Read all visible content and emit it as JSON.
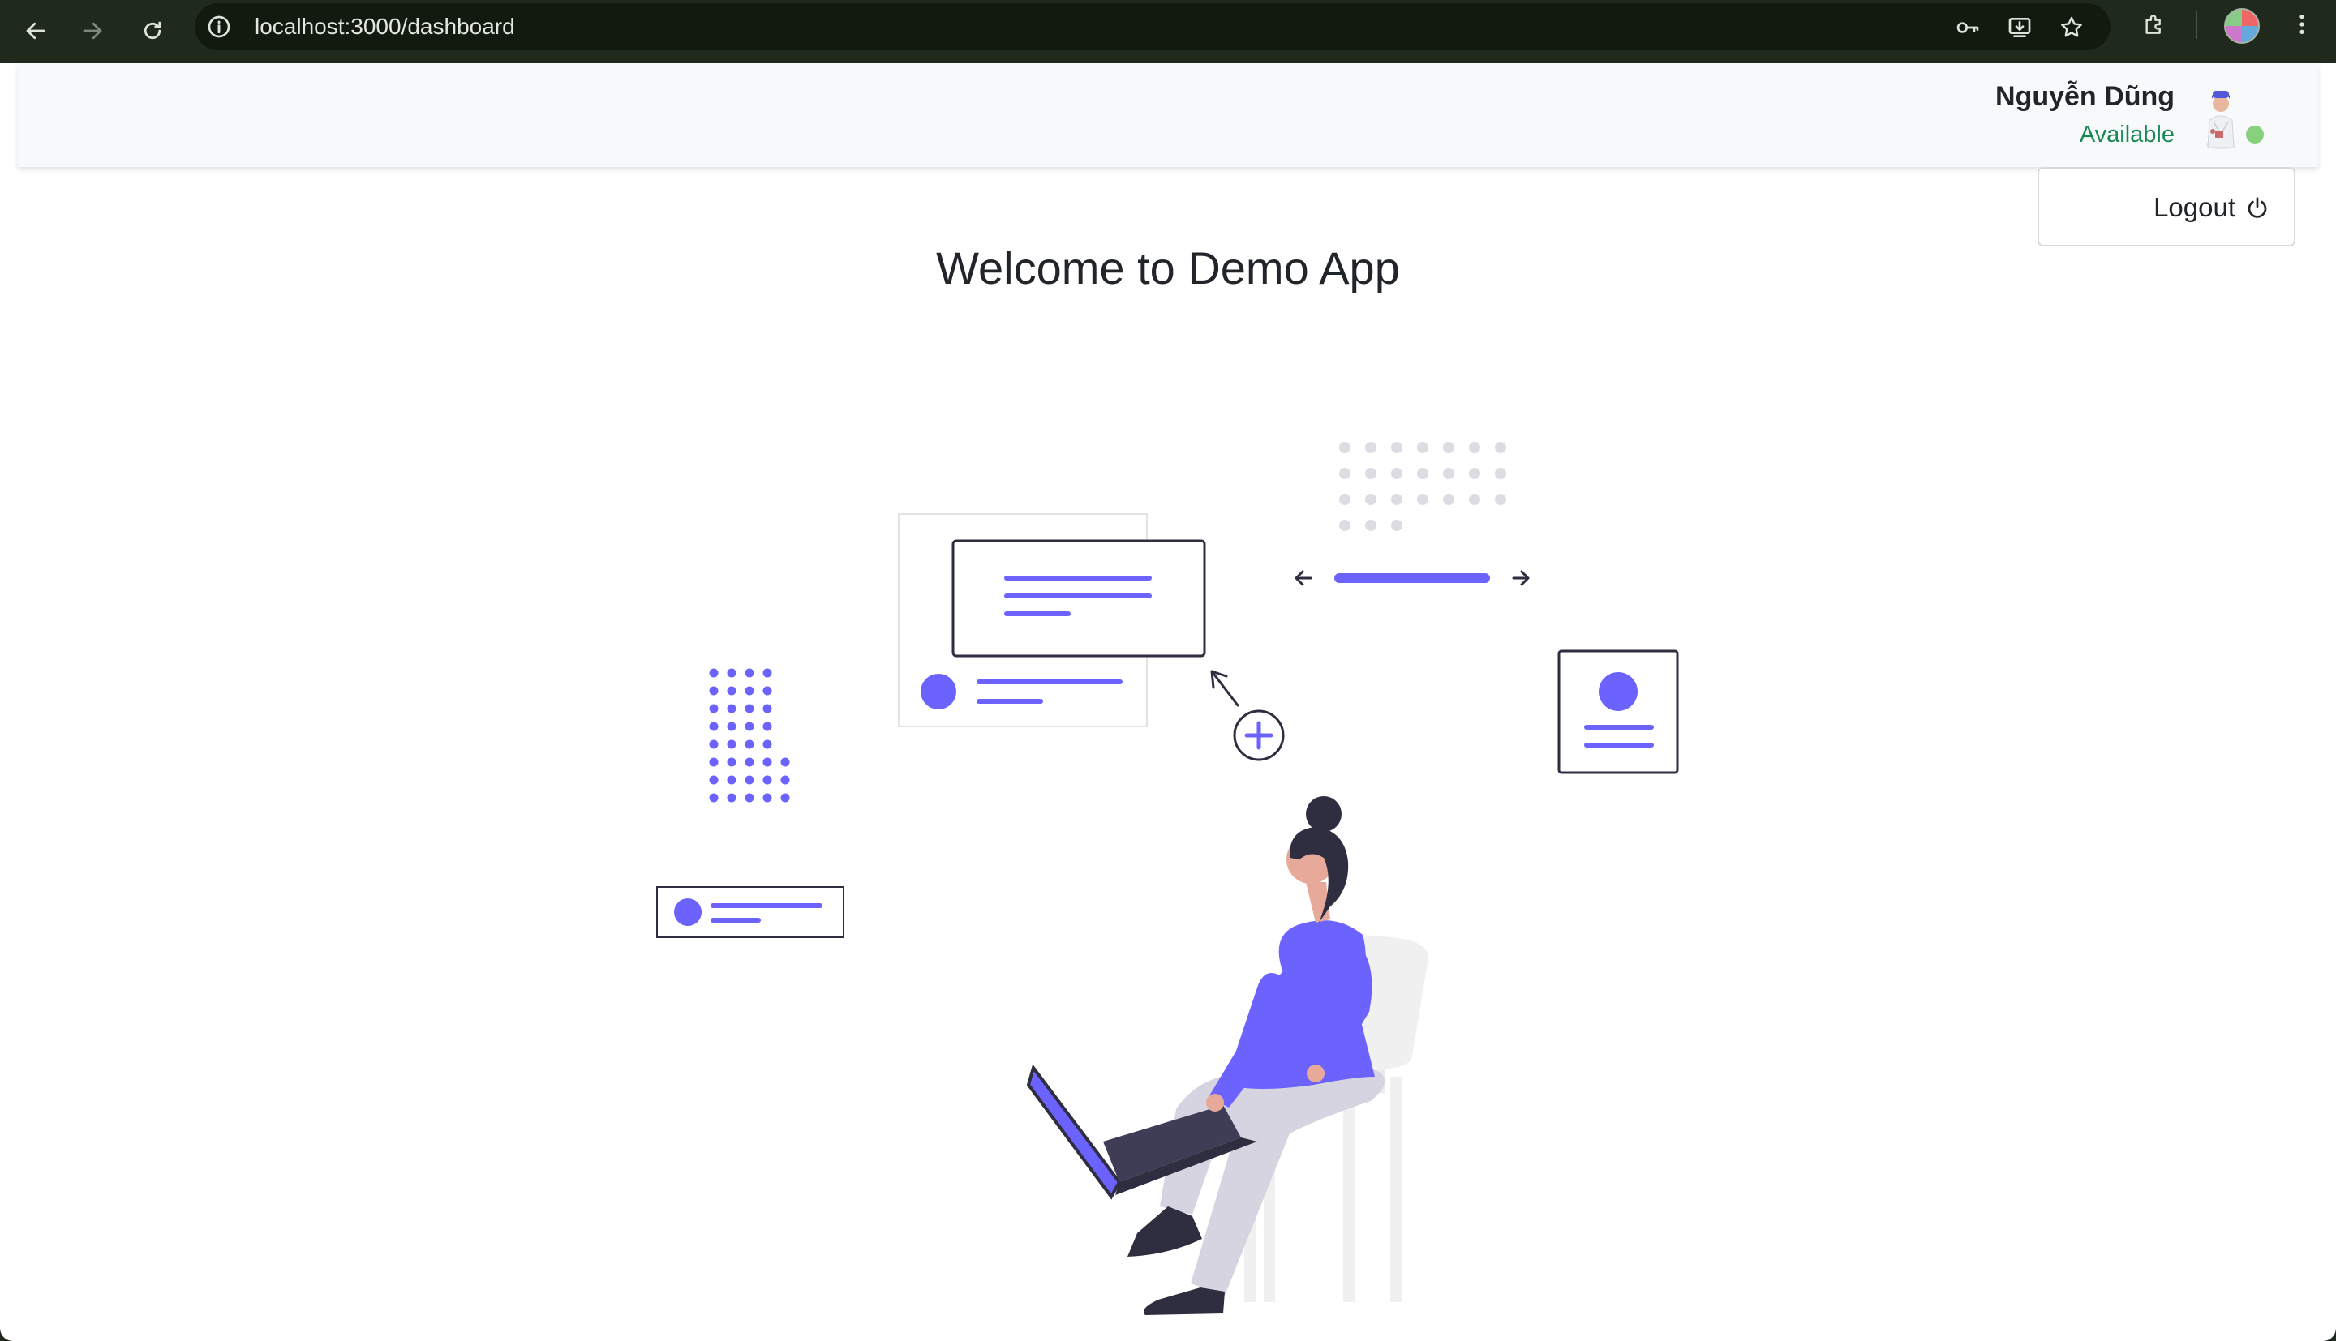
{
  "browser": {
    "url": "localhost:3000/dashboard",
    "icons": [
      "back-icon",
      "forward-icon",
      "reload-icon",
      "info-icon",
      "password-key-icon",
      "install-app-icon",
      "bookmark-star-icon",
      "extensions-icon",
      "profile-avatar",
      "more-menu-icon"
    ]
  },
  "header": {
    "user_name": "Nguyễn Dũng",
    "status": "Available",
    "status_color": "#198754",
    "presence_color": "#86d07e"
  },
  "menu": {
    "logout_label": "Logout",
    "logout_icon": "power-icon"
  },
  "main": {
    "title": "Welcome to Demo App",
    "accent_color": "#6c63ff"
  }
}
